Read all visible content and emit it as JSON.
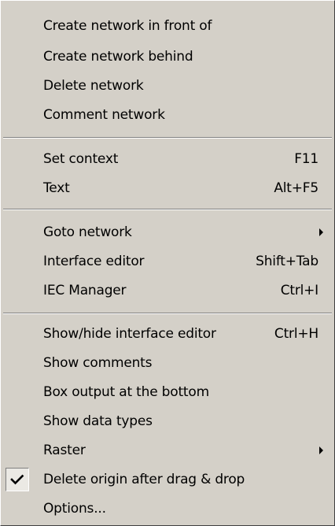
{
  "menu": {
    "groups": [
      {
        "items": [
          {
            "label": "Create network in front of"
          },
          {
            "label": "Create network behind"
          },
          {
            "label": "Delete network"
          },
          {
            "label": "Comment network"
          }
        ]
      },
      {
        "items": [
          {
            "label": "Set context",
            "shortcut": "F11"
          },
          {
            "label": "Text",
            "shortcut": "Alt+F5"
          }
        ]
      },
      {
        "items": [
          {
            "label": "Goto network",
            "submenu": true
          },
          {
            "label": "Interface editor",
            "shortcut": "Shift+Tab"
          },
          {
            "label": "IEC Manager",
            "shortcut": "Ctrl+I"
          }
        ]
      },
      {
        "items": [
          {
            "label": "Show/hide interface editor",
            "shortcut": "Ctrl+H"
          },
          {
            "label": "Show comments"
          },
          {
            "label": "Box output at the bottom"
          },
          {
            "label": "Show data types"
          },
          {
            "label": "Raster",
            "submenu": true
          },
          {
            "label": "Delete origin after drag & drop",
            "checked": true
          },
          {
            "label": "Options..."
          }
        ]
      }
    ]
  }
}
